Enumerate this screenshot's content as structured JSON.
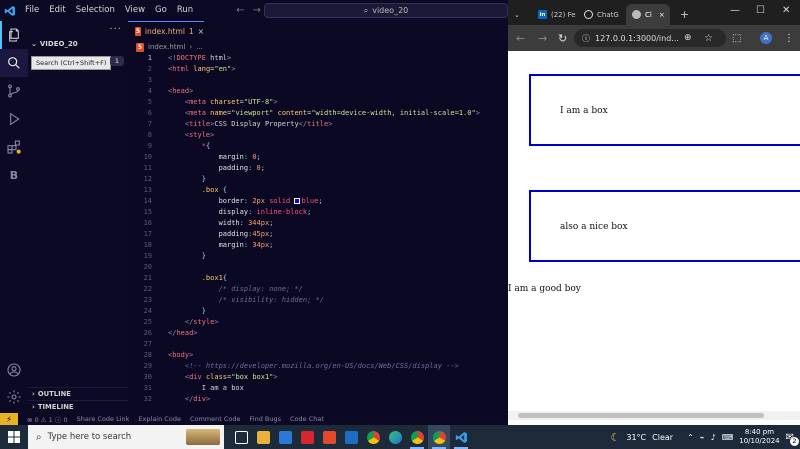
{
  "vscode": {
    "menu": [
      "File",
      "Edit",
      "Selection",
      "View",
      "Go",
      "Run"
    ],
    "menu_more": "···",
    "nav_back": "←",
    "nav_forward": "→",
    "command_center": "video_20",
    "explorer_more": "···",
    "folder_name": "VIDEO_20",
    "tooltip": "Search (Ctrl+Shift+F)",
    "badge_count": "1",
    "activity_letter": "B",
    "outline_label": "OUTLINE",
    "timeline_label": "TIMELINE",
    "tab": {
      "name": "index.html",
      "problems": "1",
      "close": "×"
    },
    "breadcrumb": [
      "index.html",
      "..."
    ],
    "statusbar": {
      "remote_icon": "⚡",
      "errors": "0",
      "warnings": "1",
      "info": "0",
      "items": [
        "Share Code Link",
        "Explain Code",
        "Comment Code",
        "Find Bugs",
        "Code Chat"
      ]
    },
    "colors": {
      "bg": "#0b0824",
      "accent": "#5c8dff",
      "tag": "#f07178",
      "string": "#c3e88d"
    },
    "code_lines": [
      {
        "n": "1",
        "cur": true,
        "parts": [
          [
            "t-br",
            "<!"
          ],
          [
            "t-tag",
            "DOCTYPE"
          ],
          [
            "code",
            " html"
          ],
          [
            "t-br",
            ">"
          ]
        ]
      },
      {
        "n": "2",
        "parts": [
          [
            "t-br",
            "<"
          ],
          [
            "t-tag",
            "html"
          ],
          [
            "code",
            " "
          ],
          [
            "t-attr",
            "lang"
          ],
          [
            "code",
            "="
          ],
          [
            "t-str",
            "\"en\""
          ],
          [
            "t-br",
            ">"
          ]
        ]
      },
      {
        "n": "3",
        "parts": []
      },
      {
        "n": "4",
        "parts": [
          [
            "t-br",
            "<"
          ],
          [
            "t-tag",
            "head"
          ],
          [
            "t-br",
            ">"
          ]
        ]
      },
      {
        "n": "5",
        "parts": [
          [
            "code",
            "    "
          ],
          [
            "t-br",
            "<"
          ],
          [
            "t-tag",
            "meta"
          ],
          [
            "code",
            " "
          ],
          [
            "t-attr",
            "charset"
          ],
          [
            "code",
            "="
          ],
          [
            "t-str",
            "\"UTF-8\""
          ],
          [
            "t-br",
            ">"
          ]
        ]
      },
      {
        "n": "6",
        "parts": [
          [
            "code",
            "    "
          ],
          [
            "t-br",
            "<"
          ],
          [
            "t-tag",
            "meta"
          ],
          [
            "code",
            " "
          ],
          [
            "t-attr",
            "name"
          ],
          [
            "code",
            "="
          ],
          [
            "t-str",
            "\"viewport\""
          ],
          [
            "code",
            " "
          ],
          [
            "t-attr",
            "content"
          ],
          [
            "code",
            "="
          ],
          [
            "t-str",
            "\"width=device-width, initial-scale=1.0\""
          ],
          [
            "t-br",
            ">"
          ]
        ]
      },
      {
        "n": "7",
        "parts": [
          [
            "code",
            "    "
          ],
          [
            "t-br",
            "<"
          ],
          [
            "t-tag",
            "title"
          ],
          [
            "t-br",
            ">"
          ],
          [
            "code",
            "CSS Display Property"
          ],
          [
            "t-br",
            "</"
          ],
          [
            "t-tag",
            "title"
          ],
          [
            "t-br",
            ">"
          ]
        ]
      },
      {
        "n": "8",
        "parts": [
          [
            "code",
            "    "
          ],
          [
            "t-br",
            "<"
          ],
          [
            "t-tag",
            "style"
          ],
          [
            "t-br",
            ">"
          ]
        ]
      },
      {
        "n": "9",
        "parts": [
          [
            "code",
            "        "
          ],
          [
            "t-val",
            "*"
          ],
          [
            "t-pun",
            "{"
          ]
        ]
      },
      {
        "n": "10",
        "parts": [
          [
            "code",
            "            "
          ],
          [
            "t-prop",
            "margin"
          ],
          [
            "t-pun",
            ": "
          ],
          [
            "t-num",
            "0"
          ],
          [
            "t-pun",
            ";"
          ]
        ]
      },
      {
        "n": "11",
        "parts": [
          [
            "code",
            "            "
          ],
          [
            "t-prop",
            "padding"
          ],
          [
            "t-pun",
            ": "
          ],
          [
            "t-num",
            "0"
          ],
          [
            "t-pun",
            ";"
          ]
        ]
      },
      {
        "n": "12",
        "parts": [
          [
            "code",
            "        "
          ],
          [
            "t-pun",
            "}"
          ]
        ]
      },
      {
        "n": "13",
        "parts": [
          [
            "code",
            "        "
          ],
          [
            "t-sel",
            ".box"
          ],
          [
            "code",
            " "
          ],
          [
            "t-pun",
            "{"
          ]
        ]
      },
      {
        "n": "14",
        "parts": [
          [
            "code",
            "            "
          ],
          [
            "t-prop",
            "border"
          ],
          [
            "t-pun",
            ": "
          ],
          [
            "t-num",
            "2px"
          ],
          [
            "code",
            " "
          ],
          [
            "t-val",
            "solid"
          ],
          [
            "code",
            " "
          ],
          [
            "swatch",
            ""
          ],
          [
            "t-val",
            "blue"
          ],
          [
            "t-pun",
            ";"
          ]
        ]
      },
      {
        "n": "15",
        "parts": [
          [
            "code",
            "            "
          ],
          [
            "t-prop",
            "display"
          ],
          [
            "t-pun",
            ": "
          ],
          [
            "t-val",
            "inline-block"
          ],
          [
            "t-pun",
            ";"
          ]
        ]
      },
      {
        "n": "16",
        "parts": [
          [
            "code",
            "            "
          ],
          [
            "t-prop",
            "width"
          ],
          [
            "t-pun",
            ": "
          ],
          [
            "t-num",
            "344px"
          ],
          [
            "t-pun",
            ";"
          ]
        ]
      },
      {
        "n": "17",
        "parts": [
          [
            "code",
            "            "
          ],
          [
            "t-prop",
            "padding"
          ],
          [
            "t-pun",
            ":"
          ],
          [
            "t-num",
            "45px"
          ],
          [
            "t-pun",
            ";"
          ]
        ]
      },
      {
        "n": "18",
        "parts": [
          [
            "code",
            "            "
          ],
          [
            "t-prop",
            "margin"
          ],
          [
            "t-pun",
            ": "
          ],
          [
            "t-num",
            "34px"
          ],
          [
            "t-pun",
            ";"
          ]
        ]
      },
      {
        "n": "19",
        "parts": [
          [
            "code",
            "        "
          ],
          [
            "t-pun",
            "}"
          ]
        ]
      },
      {
        "n": "20",
        "parts": []
      },
      {
        "n": "21",
        "parts": [
          [
            "code",
            "        "
          ],
          [
            "t-sel",
            ".box1"
          ],
          [
            "t-pun",
            "{"
          ]
        ]
      },
      {
        "n": "22",
        "parts": [
          [
            "code",
            "            "
          ],
          [
            "t-com",
            "/* display: none; */"
          ]
        ]
      },
      {
        "n": "23",
        "parts": [
          [
            "code",
            "            "
          ],
          [
            "t-com",
            "/* visibility: hidden; */"
          ]
        ]
      },
      {
        "n": "24",
        "parts": [
          [
            "code",
            "        "
          ],
          [
            "t-pun",
            "}"
          ]
        ]
      },
      {
        "n": "25",
        "parts": [
          [
            "code",
            "    "
          ],
          [
            "t-br",
            "</"
          ],
          [
            "t-tag",
            "style"
          ],
          [
            "t-br",
            ">"
          ]
        ]
      },
      {
        "n": "26",
        "parts": [
          [
            "t-br",
            "</"
          ],
          [
            "t-tag",
            "head"
          ],
          [
            "t-br",
            ">"
          ]
        ]
      },
      {
        "n": "27",
        "parts": []
      },
      {
        "n": "28",
        "parts": [
          [
            "t-br",
            "<"
          ],
          [
            "t-tag",
            "body"
          ],
          [
            "t-br",
            ">"
          ]
        ]
      },
      {
        "n": "29",
        "parts": [
          [
            "code",
            "    "
          ],
          [
            "t-com",
            "<!-- https://developer.mozilla.org/en-US/docs/Web/CSS/display -->"
          ]
        ]
      },
      {
        "n": "30",
        "parts": [
          [
            "code",
            "    "
          ],
          [
            "t-br",
            "<"
          ],
          [
            "t-tag",
            "div"
          ],
          [
            "code",
            " "
          ],
          [
            "t-attr",
            "class"
          ],
          [
            "code",
            "="
          ],
          [
            "t-str",
            "\"box box1\""
          ],
          [
            "t-br",
            ">"
          ]
        ]
      },
      {
        "n": "31",
        "parts": [
          [
            "code",
            "        I am a box"
          ]
        ]
      },
      {
        "n": "32",
        "parts": [
          [
            "code",
            "    "
          ],
          [
            "t-br",
            "</"
          ],
          [
            "t-tag",
            "div"
          ],
          [
            "t-br",
            ">"
          ]
        ]
      }
    ]
  },
  "chrome": {
    "tabs": [
      {
        "label": "(22) Fe",
        "icon": "in"
      },
      {
        "label": "ChatG",
        "icon": "gpt"
      },
      {
        "label": "Cl",
        "icon": "globe",
        "active": true
      }
    ],
    "tab_close": "×",
    "new_tab": "+",
    "window_controls": [
      "—",
      "☐",
      "✕"
    ],
    "url": "127.0.0.1:3000/ind...",
    "profile_letter": "A",
    "page": {
      "box1_text": "I am a box",
      "box2_text": "also a nice box",
      "plain_text": "I am a good boy"
    }
  },
  "taskbar": {
    "search_placeholder": "Type here to search",
    "weather_temp": "31°C",
    "weather_text": "Clear",
    "time": "8:40 pm",
    "date": "10/10/2024",
    "notification_count": "2",
    "icons": [
      "task-view",
      "file-explorer",
      "mail",
      "acrobat",
      "office",
      "outlook",
      "chrome",
      "edge",
      "chrome-2",
      "chrome-3",
      "vscode"
    ]
  }
}
